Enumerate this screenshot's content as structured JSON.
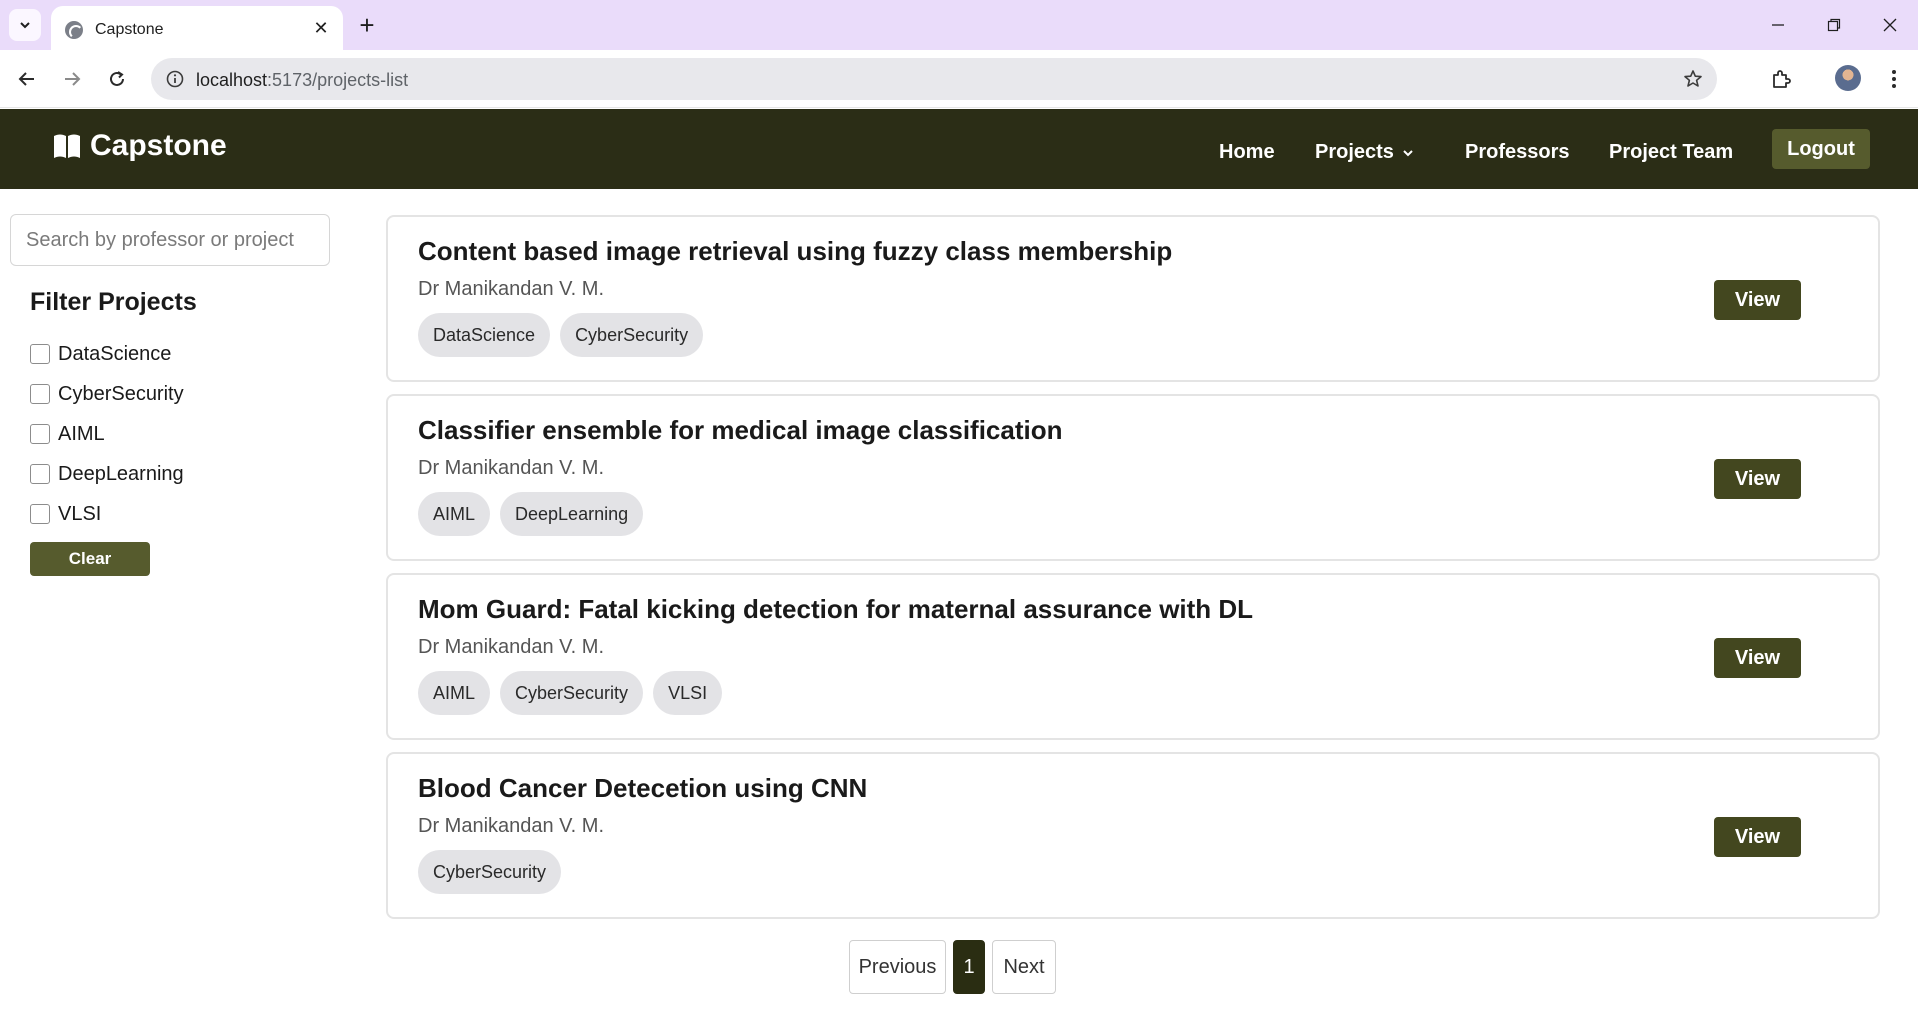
{
  "browser": {
    "tab_title": "Capstone",
    "url_host": "localhost",
    "url_rest": ":5173/projects-list"
  },
  "header": {
    "brand": "Capstone",
    "nav": {
      "home": "Home",
      "projects": "Projects",
      "professors": "Professors",
      "project_team": "Project Team"
    },
    "logout": "Logout"
  },
  "sidebar": {
    "search_placeholder": "Search by professor or project",
    "filter_title": "Filter Projects",
    "filters": [
      "DataScience",
      "CyberSecurity",
      "AIML",
      "DeepLearning",
      "VLSI"
    ],
    "clear": "Clear"
  },
  "projects": [
    {
      "title": "Content based image retrieval using fuzzy class membership",
      "professor": "Dr Manikandan V. M.",
      "tags": [
        "DataScience",
        "CyberSecurity"
      ],
      "action": "View"
    },
    {
      "title": "Classifier ensemble for medical image classification",
      "professor": "Dr Manikandan V. M.",
      "tags": [
        "AIML",
        "DeepLearning"
      ],
      "action": "View"
    },
    {
      "title": "Mom Guard: Fatal kicking detection for maternal assurance with DL",
      "professor": "Dr Manikandan V. M.",
      "tags": [
        "AIML",
        "CyberSecurity",
        "VLSI"
      ],
      "action": "View"
    },
    {
      "title": "Blood Cancer Detecetion using CNN",
      "professor": "Dr Manikandan V. M.",
      "tags": [
        "CyberSecurity"
      ],
      "action": "View"
    }
  ],
  "pagination": {
    "previous": "Previous",
    "current_page": "1",
    "next": "Next"
  },
  "colors": {
    "header_bg": "#2b2d16",
    "button_bg": "#43471f",
    "tab_strip": "#eadcfa"
  }
}
